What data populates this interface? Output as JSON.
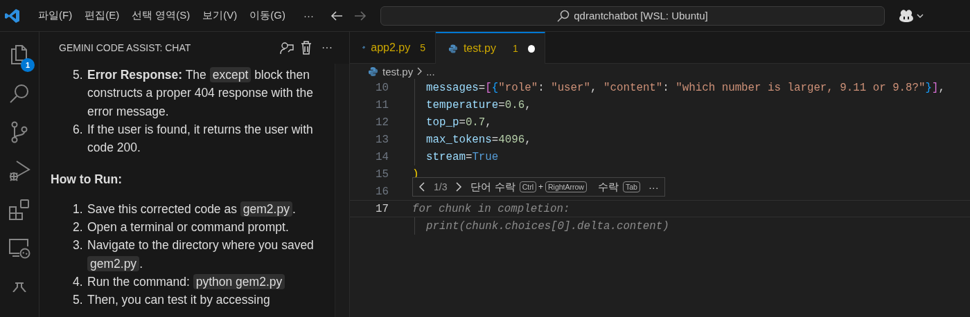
{
  "title_bar": {
    "menu": [
      "파일(F)",
      "편집(E)",
      "선택 영역(S)",
      "보기(V)",
      "이동(G)"
    ],
    "more": "···",
    "search": "qdrantchatbot [WSL: Ubuntu]",
    "back_disabled": false,
    "forward_disabled": true
  },
  "activity_bar": {
    "items": [
      {
        "kind": "explorer",
        "badge": "1"
      },
      {
        "kind": "search"
      },
      {
        "kind": "source-control"
      },
      {
        "kind": "run-debug"
      },
      {
        "kind": "extensions"
      },
      {
        "kind": "remote"
      },
      {
        "kind": "testing"
      }
    ]
  },
  "chat": {
    "title": "GEMINI CODE ASSIST: CHAT",
    "more": "···",
    "blocks": [
      {
        "kind": "item",
        "number": "5.",
        "parts": [
          {
            "kind": "text",
            "text": "**Error Response:** The"
          },
          {
            "kind": "code",
            "text": "except"
          },
          {
            "kind": "text",
            "text": "block then constructs a proper 404 response with the error message."
          }
        ]
      },
      {
        "kind": "item",
        "number": "6.",
        "parts": [
          {
            "kind": "text",
            "text": "If the user is found, it returns the user with code 200."
          }
        ]
      },
      {
        "kind": "heading",
        "text": "How to Run:"
      },
      {
        "kind": "item",
        "number": "1.",
        "parts": [
          {
            "kind": "text",
            "text": "Save this corrected code as"
          },
          {
            "kind": "code",
            "text": "gem2.py"
          },
          {
            "kind": "tail",
            "text": "."
          }
        ]
      },
      {
        "kind": "item",
        "number": "2.",
        "parts": [
          {
            "kind": "text",
            "text": "Open a terminal or command prompt."
          }
        ]
      },
      {
        "kind": "item",
        "number": "3.",
        "parts": [
          {
            "kind": "text",
            "text": "Navigate to the directory where you saved"
          },
          {
            "kind": "code",
            "text": "gem2.py"
          },
          {
            "kind": "tail",
            "text": "."
          }
        ]
      },
      {
        "kind": "item",
        "number": "4.",
        "parts": [
          {
            "kind": "text",
            "text": "Run the command:"
          },
          {
            "kind": "code",
            "text": "python gem2.py"
          }
        ]
      },
      {
        "kind": "item",
        "number": "5.",
        "parts": [
          {
            "kind": "text",
            "text": "Then, you can test it by accessing"
          }
        ]
      }
    ]
  },
  "editor": {
    "tabs": [
      {
        "label": "app2.py",
        "problems": "5",
        "selected": false,
        "dirty": false
      },
      {
        "label": "test.py",
        "problems": "1",
        "selected": true,
        "dirty": true
      }
    ],
    "breadcrumb": {
      "file": "test.py",
      "rest": "..."
    },
    "lines": [
      {
        "number": "10",
        "indented": true,
        "current": false,
        "tokens": [
          {
            "kind": "param",
            "text": "messages"
          },
          {
            "kind": "op",
            "text": "="
          },
          {
            "kind": "bracket1",
            "text": "["
          },
          {
            "kind": "bracket2",
            "text": "{"
          },
          {
            "kind": "str",
            "text": "\"role\""
          },
          {
            "kind": "op",
            "text": ": "
          },
          {
            "kind": "str",
            "text": "\"user\""
          },
          {
            "kind": "op",
            "text": ", "
          },
          {
            "kind": "str",
            "text": "\"content\""
          },
          {
            "kind": "op",
            "text": ": "
          },
          {
            "kind": "str",
            "text": "\"which number is larger, 9.11 or 9.8?\""
          },
          {
            "kind": "bracket2",
            "text": "}"
          },
          {
            "kind": "bracket1",
            "text": "]"
          },
          {
            "kind": "op",
            "text": ","
          }
        ]
      },
      {
        "number": "11",
        "indented": true,
        "current": false,
        "tokens": [
          {
            "kind": "param",
            "text": "temperature"
          },
          {
            "kind": "op",
            "text": "="
          },
          {
            "kind": "num",
            "text": "0.6"
          },
          {
            "kind": "op",
            "text": ","
          }
        ]
      },
      {
        "number": "12",
        "indented": true,
        "current": false,
        "tokens": [
          {
            "kind": "param",
            "text": "top_p"
          },
          {
            "kind": "op",
            "text": "="
          },
          {
            "kind": "num",
            "text": "0.7"
          },
          {
            "kind": "op",
            "text": ","
          }
        ]
      },
      {
        "number": "13",
        "indented": true,
        "current": false,
        "tokens": [
          {
            "kind": "param",
            "text": "max_tokens"
          },
          {
            "kind": "op",
            "text": "="
          },
          {
            "kind": "num",
            "text": "4096"
          },
          {
            "kind": "op",
            "text": ","
          }
        ]
      },
      {
        "number": "14",
        "indented": true,
        "current": false,
        "tokens": [
          {
            "kind": "param",
            "text": "stream"
          },
          {
            "kind": "op",
            "text": "="
          },
          {
            "kind": "const",
            "text": "True"
          }
        ]
      },
      {
        "number": "15",
        "indented": false,
        "current": false,
        "tokens": [
          {
            "kind": "bracket0",
            "text": ")"
          }
        ]
      },
      {
        "number": "16",
        "indented": false,
        "current": false
      },
      {
        "number": "17",
        "indented": false,
        "current": true,
        "tokens": [
          {
            "kind": "ghost",
            "text": "for chunk in completion:"
          }
        ],
        "children": [
          {
            "indented": true,
            "tokens": [
              {
                "kind": "ghost",
                "text": "print(chunk.choices[0].delta.content)"
              }
            ]
          }
        ]
      }
    ],
    "suggestion": {
      "counter": "1/3",
      "accept_word": "단어 수락",
      "accept_word_keys": [
        "Ctrl",
        "+",
        "RightArrow"
      ],
      "accept": "수락",
      "accept_keys": [
        "Tab"
      ],
      "more": "···"
    }
  }
}
